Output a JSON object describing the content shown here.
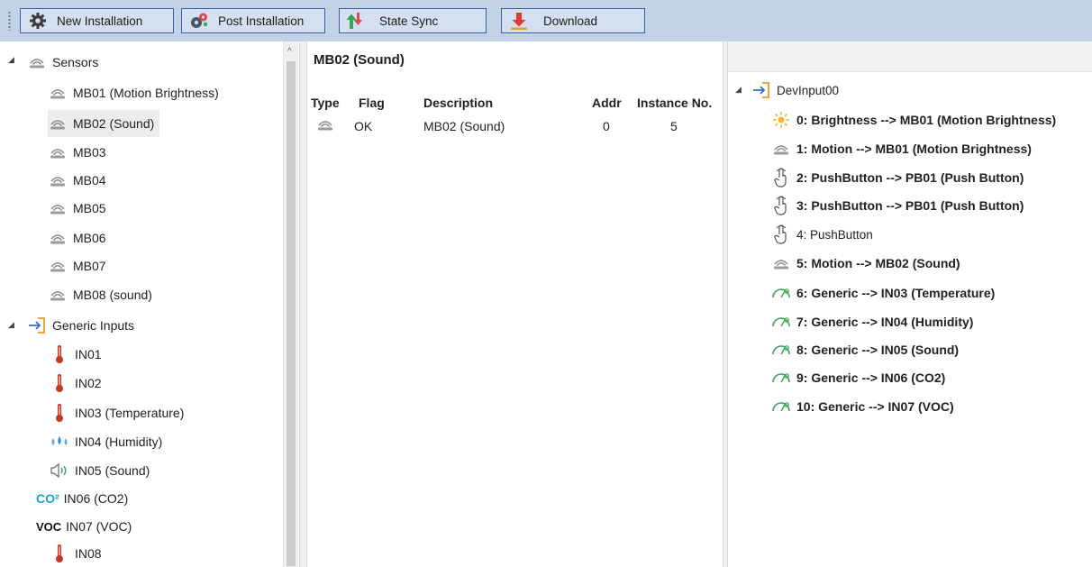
{
  "toolbar": {
    "buttons": [
      {
        "label": "New Installation",
        "icon": "gear-icon"
      },
      {
        "label": "Post Installation",
        "icon": "gears-icon"
      },
      {
        "label": "State Sync",
        "icon": "sync-arrows-icon"
      },
      {
        "label": "Download",
        "icon": "download-arrow-icon"
      }
    ]
  },
  "left_tree": {
    "sensors_label": "Sensors",
    "sensors": [
      "MB01 (Motion Brightness)",
      "MB02 (Sound)",
      "MB03",
      "MB04",
      "MB05",
      "MB06",
      "MB07",
      "MB08 (sound)"
    ],
    "generic_label": "Generic Inputs",
    "generic": [
      "IN01",
      "IN02",
      "IN03 (Temperature)",
      "IN04 (Humidity)",
      "IN05 (Sound)",
      "IN06 (CO2)",
      "IN07 (VOC)",
      "IN08"
    ],
    "co2_badge": "CO²",
    "voc_badge": "VOC"
  },
  "middle": {
    "title": "MB02 (Sound)",
    "columns": [
      "Type",
      "Flag",
      "Description",
      "Addr",
      "Instance No."
    ],
    "rows": [
      {
        "flag": "OK",
        "description": "MB02 (Sound)",
        "addr": "0",
        "instance": "5"
      }
    ]
  },
  "right_tree": {
    "root_label": "DevInput00",
    "items": [
      {
        "label": "0: Brightness --> MB01 (Motion Brightness)",
        "icon": "sun-icon",
        "bold": true
      },
      {
        "label": "1: Motion --> MB01 (Motion Brightness)",
        "icon": "sensor-icon",
        "bold": true
      },
      {
        "label": "2: PushButton --> PB01 (Push Button)",
        "icon": "hand-pointer-icon",
        "bold": true
      },
      {
        "label": "3: PushButton --> PB01 (Push Button)",
        "icon": "hand-pointer-icon",
        "bold": true
      },
      {
        "label": "4: PushButton",
        "icon": "hand-pointer-icon",
        "bold": false
      },
      {
        "label": "5: Motion --> MB02 (Sound)",
        "icon": "sensor-icon",
        "bold": true
      },
      {
        "label": "6: Generic --> IN03 (Temperature)",
        "icon": "gauge-icon",
        "bold": true
      },
      {
        "label": "7: Generic --> IN04 (Humidity)",
        "icon": "gauge-icon",
        "bold": true
      },
      {
        "label": "8: Generic --> IN05 (Sound)",
        "icon": "gauge-icon",
        "bold": true
      },
      {
        "label": "9: Generic --> IN06 (CO2)",
        "icon": "gauge-icon",
        "bold": true
      },
      {
        "label": "10: Generic --> IN07 (VOC)",
        "icon": "gauge-icon",
        "bold": true
      }
    ]
  },
  "colors": {
    "toolbar_bg": "#c2d3e8",
    "button_border": "#3a5fa8",
    "selected_row": "#ececec",
    "entry_orange": "#e89a2b",
    "gauge_green": "#3aa35a",
    "co2_blue": "#1aa0d8"
  }
}
